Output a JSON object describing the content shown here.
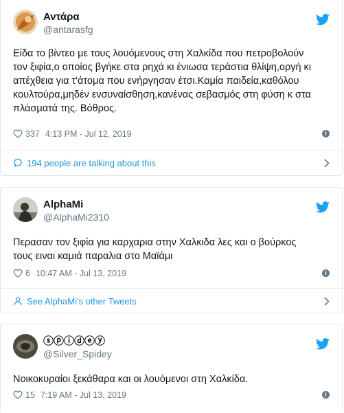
{
  "tweets": [
    {
      "display_name": "Αντάρα",
      "handle": "@antarasfg",
      "text": "Είδα το βίντεο με τους λουόμενους στη Χαλκίδα που πετροβολούν\nτον ξιφία,ο οποίος βγήκε στα ρηχά κι ένιωσα τεράστια θλίψη,οργή κι\nαπέχθεια για τ'άτομα που ενήργησαν έτσι.Καμία παιδεία,καθόλου\nκουλτούρα,μηδέν ενσυναίσθηση,κανένας σεβασμός στη φύση κ στα\nπλάσματά της. Βόθρος.",
      "likes": "337",
      "timestamp": "4:13 PM - Jul 12, 2019",
      "footer": "194 people are talking about this",
      "footer_icon": "comment-icon"
    },
    {
      "display_name": "AlphaMi",
      "handle": "@AlphaMi2310",
      "text": "Περασαν τον ξιφία για καρχαρια στην Χαλκιδα λες και ο βούρκος\nτους ειναι καμιά παραλια στο Μαϊάμι",
      "likes": "6",
      "timestamp": "10:47 AM - Jul 13, 2019",
      "footer": "See AlphaMi's other Tweets",
      "footer_icon": "person-icon"
    },
    {
      "display_name": "ⓢⓟⓘⓓⓔⓨ",
      "handle": "@Silver_Spidey",
      "text": "Νοικοκυραίοι ξεκάθαρα και οι λουόμενοι στη Χαλκίδα.",
      "likes": "15",
      "timestamp": "7:19 AM - Jul 13, 2019"
    }
  ],
  "colors": {
    "twitter_blue": "#1da1f2",
    "link_blue": "#1b95e0",
    "muted": "#657786",
    "border": "#e1e8ed"
  }
}
